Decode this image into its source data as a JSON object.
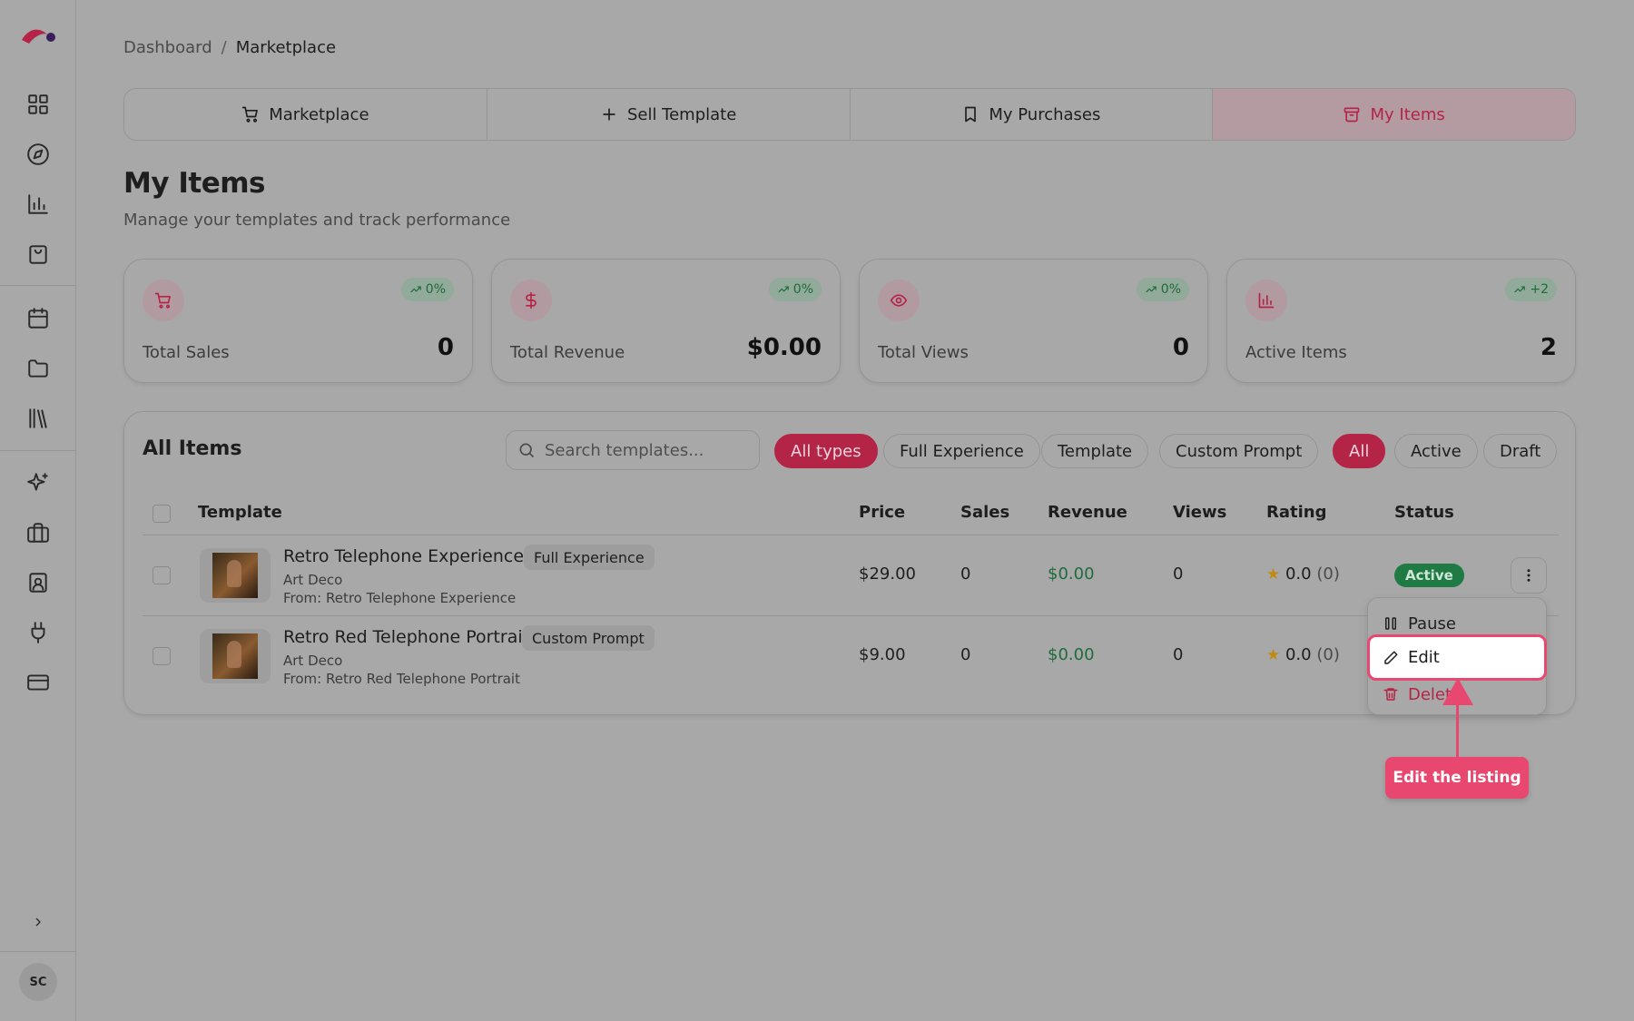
{
  "sidebar": {
    "nav_icons": [
      "dashboard-grid-icon",
      "compass-icon",
      "bar-chart-icon",
      "shopping-bag-icon",
      "calendar-icon",
      "folder-icon",
      "library-icon",
      "sparkles-icon",
      "briefcase-icon",
      "contact-card-icon",
      "plug-icon",
      "credit-card-icon"
    ],
    "avatar_initials": "SC"
  },
  "breadcrumb": {
    "parent": "Dashboard",
    "separator": "/",
    "current": "Marketplace"
  },
  "tabs": [
    {
      "label": "Marketplace",
      "icon": "cart-icon",
      "active": false
    },
    {
      "label": "Sell Template",
      "icon": "plus-icon",
      "active": false
    },
    {
      "label": "My Purchases",
      "icon": "bookmark-icon",
      "active": false
    },
    {
      "label": "My Items",
      "icon": "archive-icon",
      "active": true
    }
  ],
  "header": {
    "title": "My Items",
    "subtitle": "Manage your templates and track performance"
  },
  "stats": [
    {
      "label": "Total Sales",
      "value": "0",
      "badge": "0%",
      "icon": "cart-icon"
    },
    {
      "label": "Total Revenue",
      "value": "$0.00",
      "badge": "0%",
      "icon": "dollar-icon"
    },
    {
      "label": "Total Views",
      "value": "0",
      "badge": "0%",
      "icon": "eye-icon"
    },
    {
      "label": "Active Items",
      "value": "2",
      "badge": "+2",
      "icon": "bar-chart-icon"
    }
  ],
  "items_panel": {
    "title": "All Items",
    "search_placeholder": "Search templates...",
    "type_filters": [
      "All types",
      "Full Experience",
      "Template",
      "Custom Prompt"
    ],
    "selected_type_filter": "All types",
    "status_filters": [
      "All",
      "Active",
      "Draft"
    ],
    "selected_status_filter": "All",
    "columns": [
      "Template",
      "Price",
      "Sales",
      "Revenue",
      "Views",
      "Rating",
      "Status"
    ],
    "rows": [
      {
        "name": "Retro Telephone Experience",
        "type": "Full Experience",
        "category": "Art Deco",
        "source": "From: Retro Telephone Experience",
        "price": "$29.00",
        "sales": "0",
        "revenue": "$0.00",
        "views": "0",
        "rating": "0.0",
        "rating_count": "(0)",
        "status": "Active"
      },
      {
        "name": "Retro Red Telephone Portrait",
        "type": "Custom Prompt",
        "category": "Art Deco",
        "source": "From: Retro Red Telephone Portrait",
        "price": "$9.00",
        "sales": "0",
        "revenue": "$0.00",
        "views": "0",
        "rating": "0.0",
        "rating_count": "(0)",
        "status": ""
      }
    ]
  },
  "row_menu": {
    "items": [
      {
        "label": "Pause",
        "icon": "pause-icon"
      },
      {
        "label": "Edit",
        "icon": "pencil-icon"
      },
      {
        "label": "Delete",
        "icon": "trash-icon"
      }
    ],
    "visible_delete_label": "Delet"
  },
  "annotation": {
    "callout_text": "Edit the listing"
  },
  "colors": {
    "accent": "#b42446",
    "highlight": "#e8476f",
    "success": "#1f7a44",
    "overlay_bg": "#a8a8a8"
  }
}
